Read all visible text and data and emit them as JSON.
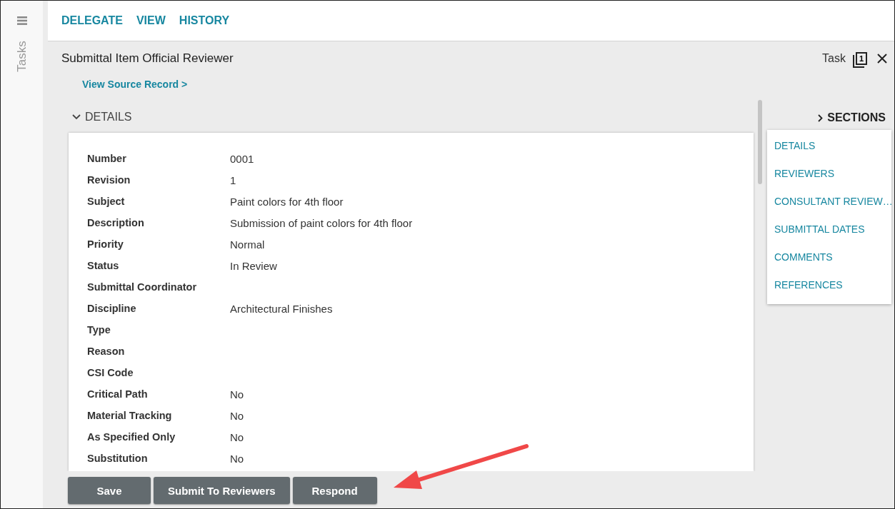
{
  "sidebar": {
    "label": "Tasks"
  },
  "toolbar": {
    "actions": [
      "DELEGATE",
      "VIEW",
      "HISTORY"
    ]
  },
  "header": {
    "title": "Submittal Item Official Reviewer",
    "source_link": "View Source Record >",
    "task_label": "Task",
    "task_count": "1"
  },
  "details": {
    "heading": "DETAILS",
    "expanded": true,
    "fields": [
      {
        "label": "Number",
        "value": "0001"
      },
      {
        "label": "Revision",
        "value": "1"
      },
      {
        "label": "Subject",
        "value": "Paint colors for 4th floor"
      },
      {
        "label": "Description",
        "value": "Submission of paint colors for 4th floor"
      },
      {
        "label": "Priority",
        "value": "Normal"
      },
      {
        "label": "Status",
        "value": "In Review"
      },
      {
        "label": "Submittal Coordinator"
      },
      {
        "label": "Discipline",
        "value": "Architectural Finishes"
      },
      {
        "label": "Type"
      },
      {
        "label": "Reason"
      },
      {
        "label": "CSI Code"
      },
      {
        "label": "Critical Path",
        "value": "No"
      },
      {
        "label": "Material Tracking",
        "value": "No"
      },
      {
        "label": "As Specified Only",
        "value": "No"
      },
      {
        "label": "Substitution",
        "value": "No"
      }
    ]
  },
  "sections": {
    "heading": "SECTIONS",
    "items": [
      "DETAILS",
      "REVIEWERS",
      "CONSULTANT REVIEW…",
      "SUBMITTAL DATES",
      "COMMENTS",
      "REFERENCES"
    ]
  },
  "buttons": [
    "Save",
    "Submit To Reviewers",
    "Respond"
  ]
}
